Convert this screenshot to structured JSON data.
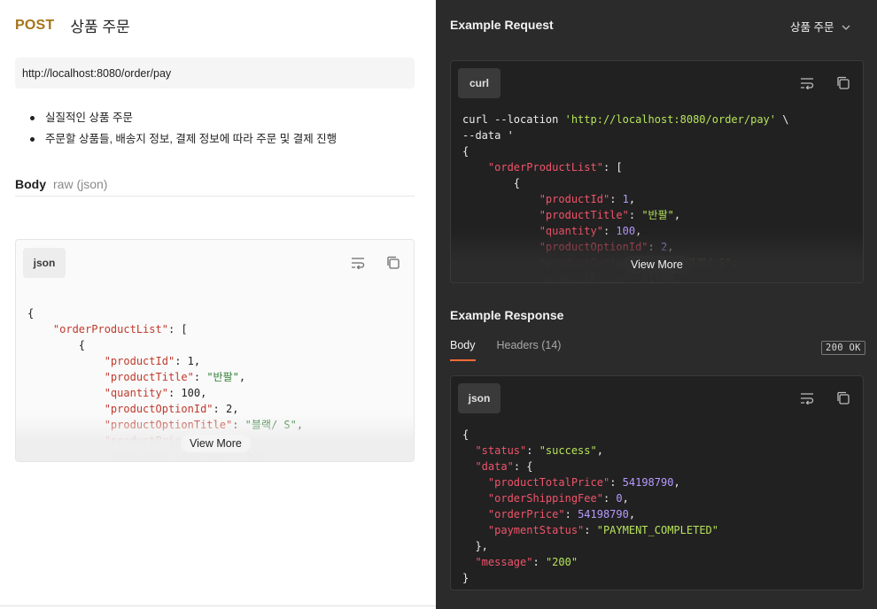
{
  "request": {
    "method": "POST",
    "name": "상품 주문",
    "url": "http://localhost:8080/order/pay",
    "description": [
      "실질적인 상품 주문",
      "주문할 상품들, 배송지 정보, 결제 정보에 따라 주문 및 결제 진행"
    ],
    "body_label": "Body",
    "body_type": "raw (json)",
    "code_lang": "json",
    "view_more": "View More"
  },
  "example_request": {
    "title": "Example Request",
    "selected": "상품 주문",
    "code_lang": "curl",
    "view_more": "View More"
  },
  "example_response": {
    "title": "Example Response",
    "tabs": [
      "Body",
      "Headers (14)"
    ],
    "status": "200 OK",
    "code_lang": "json"
  },
  "icons": [
    "wrap-lines-icon",
    "copy-icon",
    "chevron-down-icon"
  ]
}
